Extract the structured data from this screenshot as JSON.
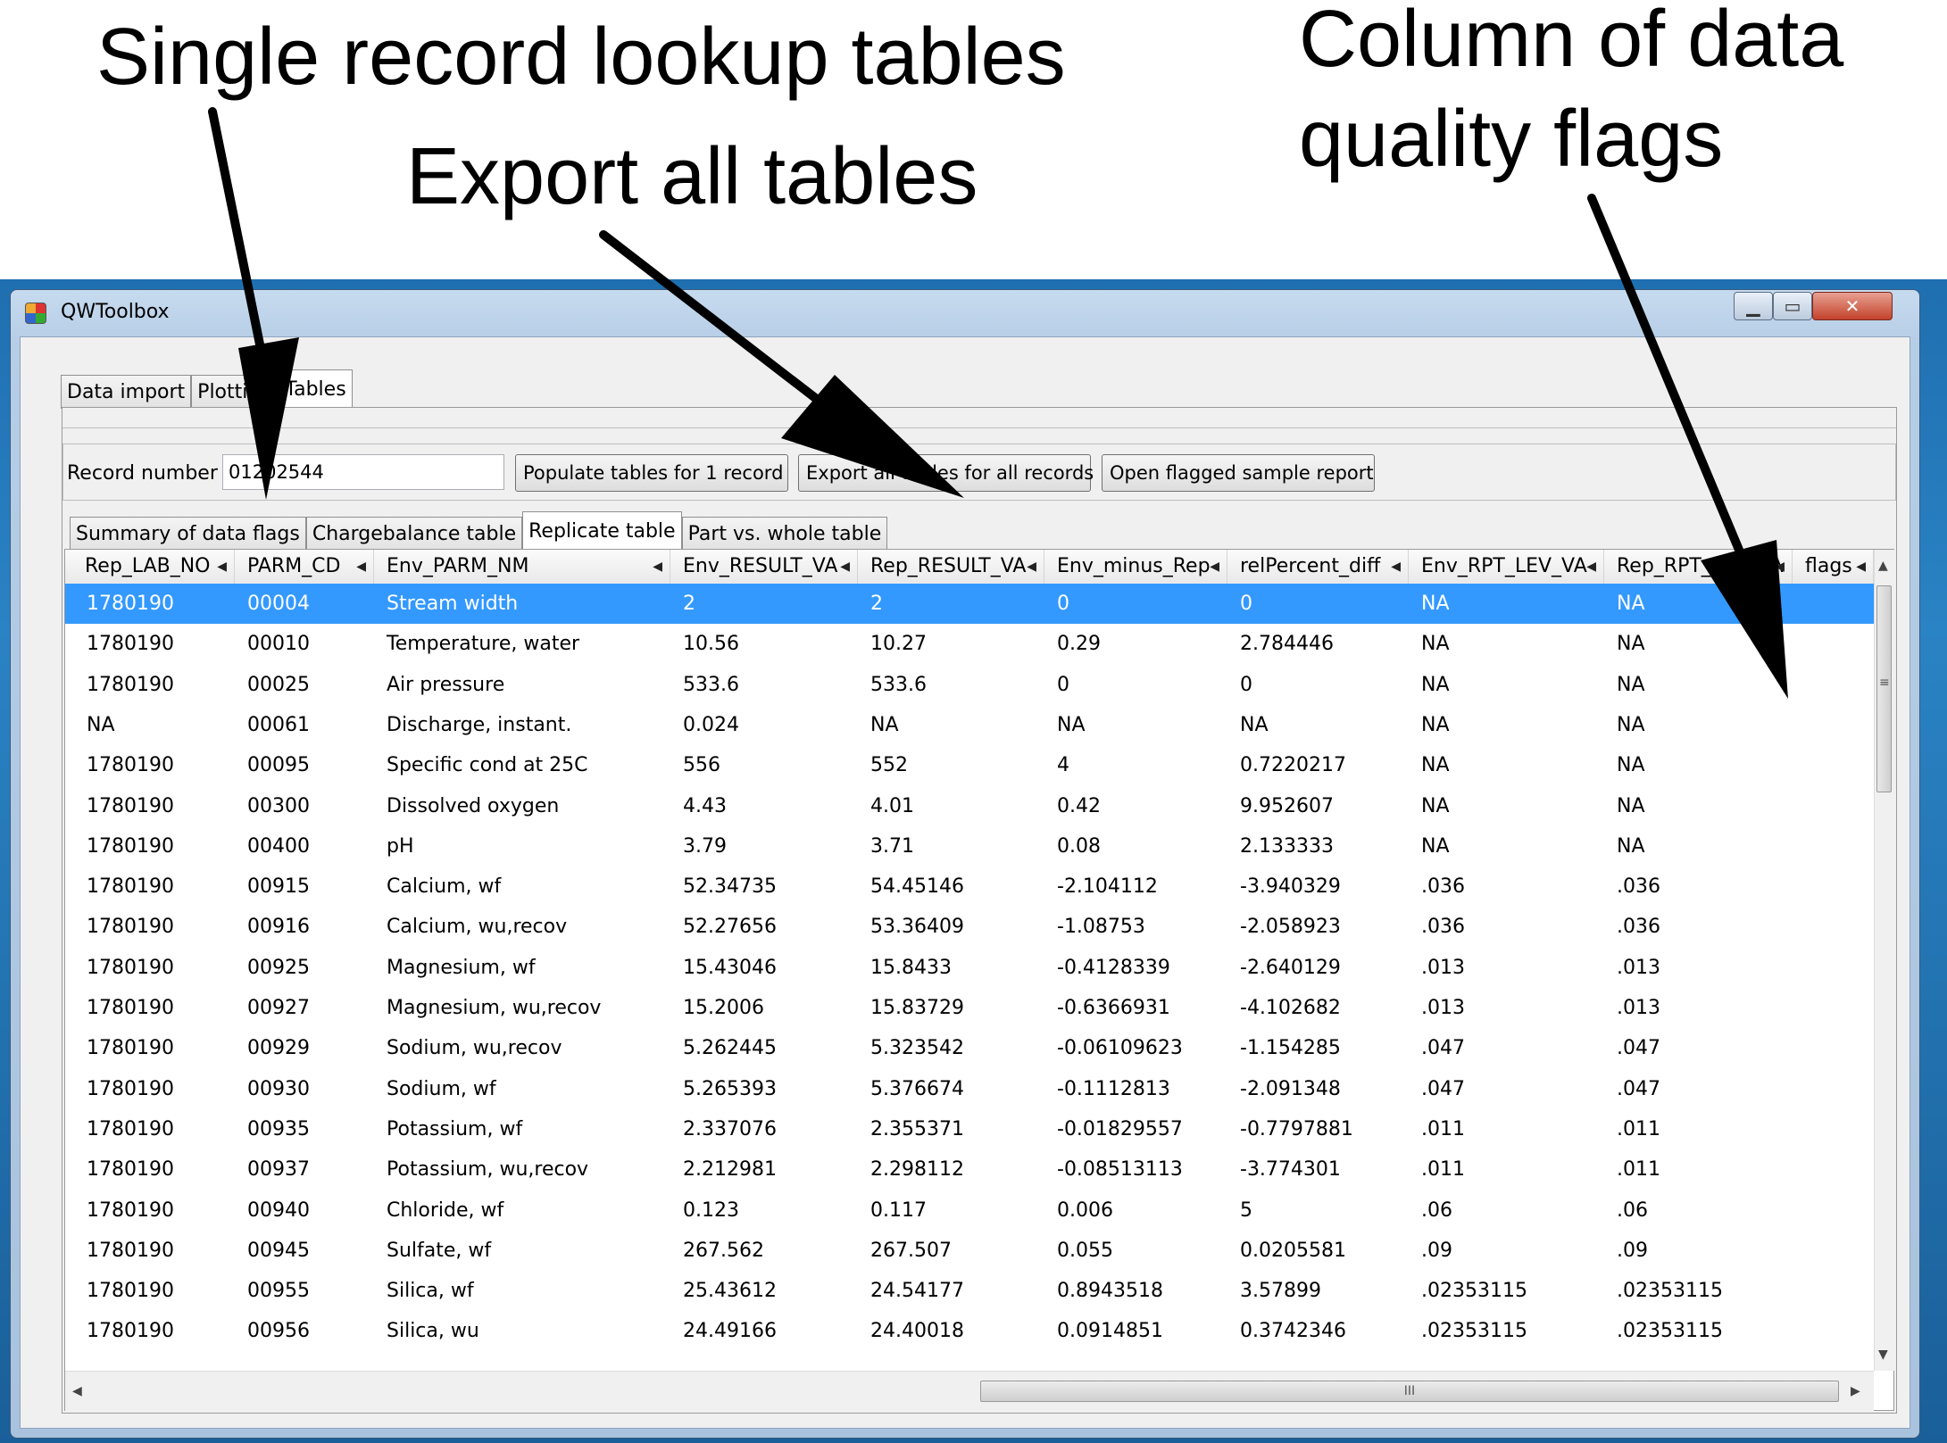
{
  "callouts": {
    "single_record": "Single record lookup tables",
    "export_all": "Export all tables",
    "flags_line1": "Column of data",
    "flags_line2": "quality flags"
  },
  "window": {
    "title": "QWToolbox",
    "minimize": "▁",
    "maximize": "▭",
    "close": "✕"
  },
  "outer_tabs": [
    "Data import",
    "Plotting",
    "Tables"
  ],
  "record": {
    "label": "Record number",
    "value": "01202544"
  },
  "buttons": {
    "populate": "Populate tables for 1 record",
    "export": "Export all tables for all records",
    "report": "Open flagged sample report"
  },
  "inner_tabs": [
    "Summary of data flags",
    "Chargebalance table",
    "Replicate table",
    "Part vs. whole table"
  ],
  "table": {
    "columns": [
      "Rep_LAB_NO",
      "PARM_CD",
      "Env_PARM_NM",
      "Env_RESULT_VA",
      "Rep_RESULT_VA",
      "Env_minus_Rep",
      "relPercent_diff",
      "Env_RPT_LEV_VA",
      "Rep_RPT_LEV_VA",
      "flags"
    ],
    "rows": [
      [
        "1780190",
        "00004",
        "Stream width",
        "2",
        "2",
        "0",
        "0",
        "NA",
        "NA",
        ""
      ],
      [
        "1780190",
        "00010",
        "Temperature, water",
        "10.56",
        "10.27",
        "0.29",
        "2.784446",
        "NA",
        "NA",
        ""
      ],
      [
        "1780190",
        "00025",
        "Air pressure",
        "533.6",
        "533.6",
        "0",
        "0",
        "NA",
        "NA",
        ""
      ],
      [
        "NA",
        "00061",
        "Discharge, instant.",
        "0.024",
        "NA",
        "NA",
        "NA",
        "NA",
        "NA",
        ""
      ],
      [
        "1780190",
        "00095",
        "Specific cond at 25C",
        "556",
        "552",
        "4",
        "0.7220217",
        "NA",
        "NA",
        ""
      ],
      [
        "1780190",
        "00300",
        "Dissolved oxygen",
        "4.43",
        "4.01",
        "0.42",
        "9.952607",
        "NA",
        "NA",
        ""
      ],
      [
        "1780190",
        "00400",
        "pH",
        "3.79",
        "3.71",
        "0.08",
        "2.133333",
        "NA",
        "NA",
        ""
      ],
      [
        "1780190",
        "00915",
        "Calcium, wf",
        "52.34735",
        "54.45146",
        "-2.104112",
        "-3.940329",
        ".036",
        ".036",
        ""
      ],
      [
        "1780190",
        "00916",
        "Calcium, wu,recov",
        "52.27656",
        "53.36409",
        "-1.08753",
        "-2.058923",
        ".036",
        ".036",
        ""
      ],
      [
        "1780190",
        "00925",
        "Magnesium, wf",
        "15.43046",
        "15.8433",
        "-0.4128339",
        "-2.640129",
        ".013",
        ".013",
        ""
      ],
      [
        "1780190",
        "00927",
        "Magnesium, wu,recov",
        "15.2006",
        "15.83729",
        "-0.6366931",
        "-4.102682",
        ".013",
        ".013",
        ""
      ],
      [
        "1780190",
        "00929",
        "Sodium, wu,recov",
        "5.262445",
        "5.323542",
        "-0.06109623",
        "-1.154285",
        ".047",
        ".047",
        ""
      ],
      [
        "1780190",
        "00930",
        "Sodium, wf",
        "5.265393",
        "5.376674",
        "-0.1112813",
        "-2.091348",
        ".047",
        ".047",
        ""
      ],
      [
        "1780190",
        "00935",
        "Potassium, wf",
        "2.337076",
        "2.355371",
        "-0.01829557",
        "-0.7797881",
        ".011",
        ".011",
        ""
      ],
      [
        "1780190",
        "00937",
        "Potassium, wu,recov",
        "2.212981",
        "2.298112",
        "-0.08513113",
        "-3.774301",
        ".011",
        ".011",
        ""
      ],
      [
        "1780190",
        "00940",
        "Chloride, wf",
        "0.123",
        "0.117",
        "0.006",
        "5",
        ".06",
        ".06",
        ""
      ],
      [
        "1780190",
        "00945",
        "Sulfate, wf",
        "267.562",
        "267.507",
        "0.055",
        "0.0205581",
        ".09",
        ".09",
        ""
      ],
      [
        "1780190",
        "00955",
        "Silica, wf",
        "25.43612",
        "24.54177",
        "0.8943518",
        "3.57899",
        ".02353115",
        ".02353115",
        ""
      ],
      [
        "1780190",
        "00956",
        "Silica, wu",
        "24.49166",
        "24.40018",
        "0.0914851",
        "0.3742346",
        ".02353115",
        ".02353115",
        ""
      ]
    ],
    "selected_row": 0
  },
  "scroll": {
    "up": "▲",
    "down": "▼",
    "left": "◀",
    "right": "▶",
    "vgrip": "≡",
    "hgrip": "III"
  },
  "colors": {
    "selection": "#3399ff",
    "desktop": "#2a83c4"
  }
}
